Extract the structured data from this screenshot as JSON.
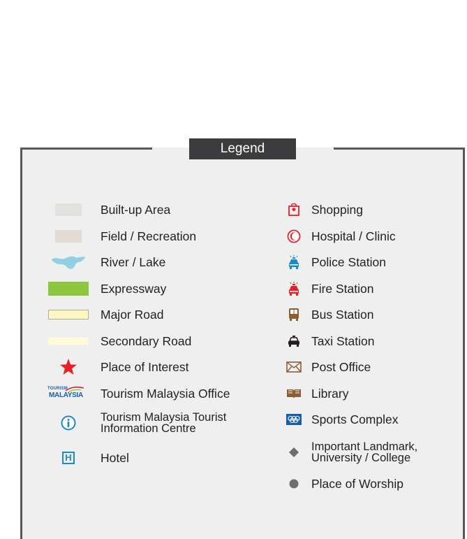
{
  "legend": {
    "title": "Legend",
    "left_items": [
      {
        "label": "Built-up Area",
        "icon": "built-up-area-swatch",
        "color": "#e3e1dd"
      },
      {
        "label": "Field / Recreation",
        "icon": "field-recreation-swatch",
        "color": "#e2dbd3"
      },
      {
        "label": "River / Lake",
        "icon": "river-lake-shape",
        "color": "#8fd0e3"
      },
      {
        "label": "Expressway",
        "icon": "expressway-swatch",
        "color": "#8dc63f"
      },
      {
        "label": "Major Road",
        "icon": "major-road-swatch",
        "color": "#fdf7c3"
      },
      {
        "label": "Secondary Road",
        "icon": "secondary-road-swatch",
        "color": "#fffbd6"
      },
      {
        "label": "Place of Interest",
        "icon": "star-icon",
        "color": "#e8202a"
      },
      {
        "label": "Tourism Malaysia Office",
        "icon": "tourism-malaysia-logo",
        "logo_text_1": "TOURISM",
        "logo_text_2": "MALAYSIA",
        "color": "#1b5ea8"
      },
      {
        "label_1": "Tourism Malaysia Tourist",
        "label_2": "Information Centre",
        "icon": "info-icon",
        "color": "#1b8ac8"
      },
      {
        "label": "Hotel",
        "icon": "hotel-icon",
        "glyph": "H",
        "color": "#1b8ac8"
      }
    ],
    "right_items": [
      {
        "label": "Shopping",
        "icon": "shopping-bag-icon",
        "color": "#e8202a"
      },
      {
        "label": "Hospital / Clinic",
        "icon": "crescent-icon",
        "color": "#e8202a"
      },
      {
        "label": "Police Station",
        "icon": "police-car-icon",
        "color": "#1b8ac8"
      },
      {
        "label": "Fire Station",
        "icon": "fire-truck-icon",
        "color": "#e8202a"
      },
      {
        "label": "Bus Station",
        "icon": "bus-icon",
        "color": "#8b5e34"
      },
      {
        "label": "Taxi Station",
        "icon": "taxi-icon",
        "color": "#231f20"
      },
      {
        "label": "Post Office",
        "icon": "envelope-icon",
        "color": "#8b5e34"
      },
      {
        "label": "Library",
        "icon": "book-icon",
        "color": "#8b5e34"
      },
      {
        "label": "Sports Complex",
        "icon": "olympic-rings-icon",
        "color": "#1b5ea8"
      },
      {
        "label_1": "Important Landmark,",
        "label_2": "University / College",
        "icon": "diamond-icon",
        "color": "#6d6e71"
      },
      {
        "label": "Place of Worship",
        "icon": "circle-icon",
        "color": "#6d6e71"
      }
    ]
  }
}
